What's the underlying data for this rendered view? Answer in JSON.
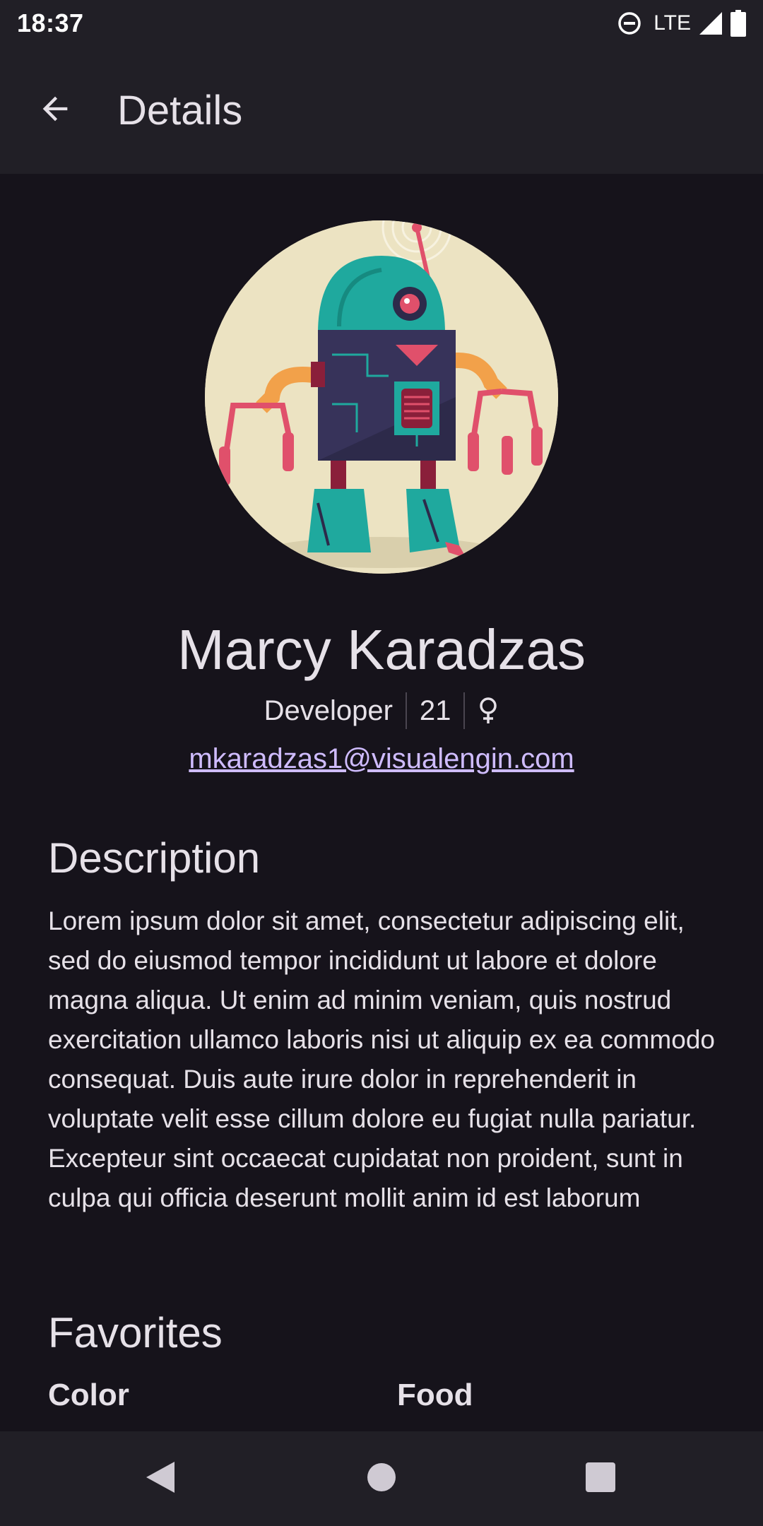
{
  "status_bar": {
    "time": "18:37",
    "network": "LTE",
    "icons": [
      "do-not-disturb-icon",
      "signal-icon",
      "battery-icon"
    ]
  },
  "app_bar": {
    "title": "Details",
    "back_icon": "arrow-back-icon"
  },
  "profile": {
    "avatar": "robot-avatar",
    "name": "Marcy Karadzas",
    "job": "Developer",
    "age": "21",
    "gender_icon": "female-icon",
    "email": "mkaradzas1@visualengin.com"
  },
  "description": {
    "heading": "Description",
    "text": "Lorem ipsum dolor sit amet, consectetur adipiscing elit, sed do eiusmod tempor incididunt ut labore et dolore magna aliqua. Ut enim ad minim veniam, quis nostrud exercitation ullamco laboris nisi ut aliquip ex ea commodo consequat. Duis aute irure dolor in reprehenderit in voluptate velit esse cillum dolore eu fugiat nulla pariatur. Excepteur sint occaecat cupidatat non proident, sunt in culpa qui officia deserunt mollit anim id est laborum"
  },
  "favorites": {
    "heading": "Favorites",
    "color_label": "Color",
    "food_label": "Food"
  },
  "nav_bar": {
    "icons": [
      "nav-back-icon",
      "nav-home-icon",
      "nav-recents-icon"
    ]
  },
  "colors": {
    "background": "#16131b",
    "surface": "#211f26",
    "text": "#e6e1e8",
    "link": "#cfbcff"
  }
}
